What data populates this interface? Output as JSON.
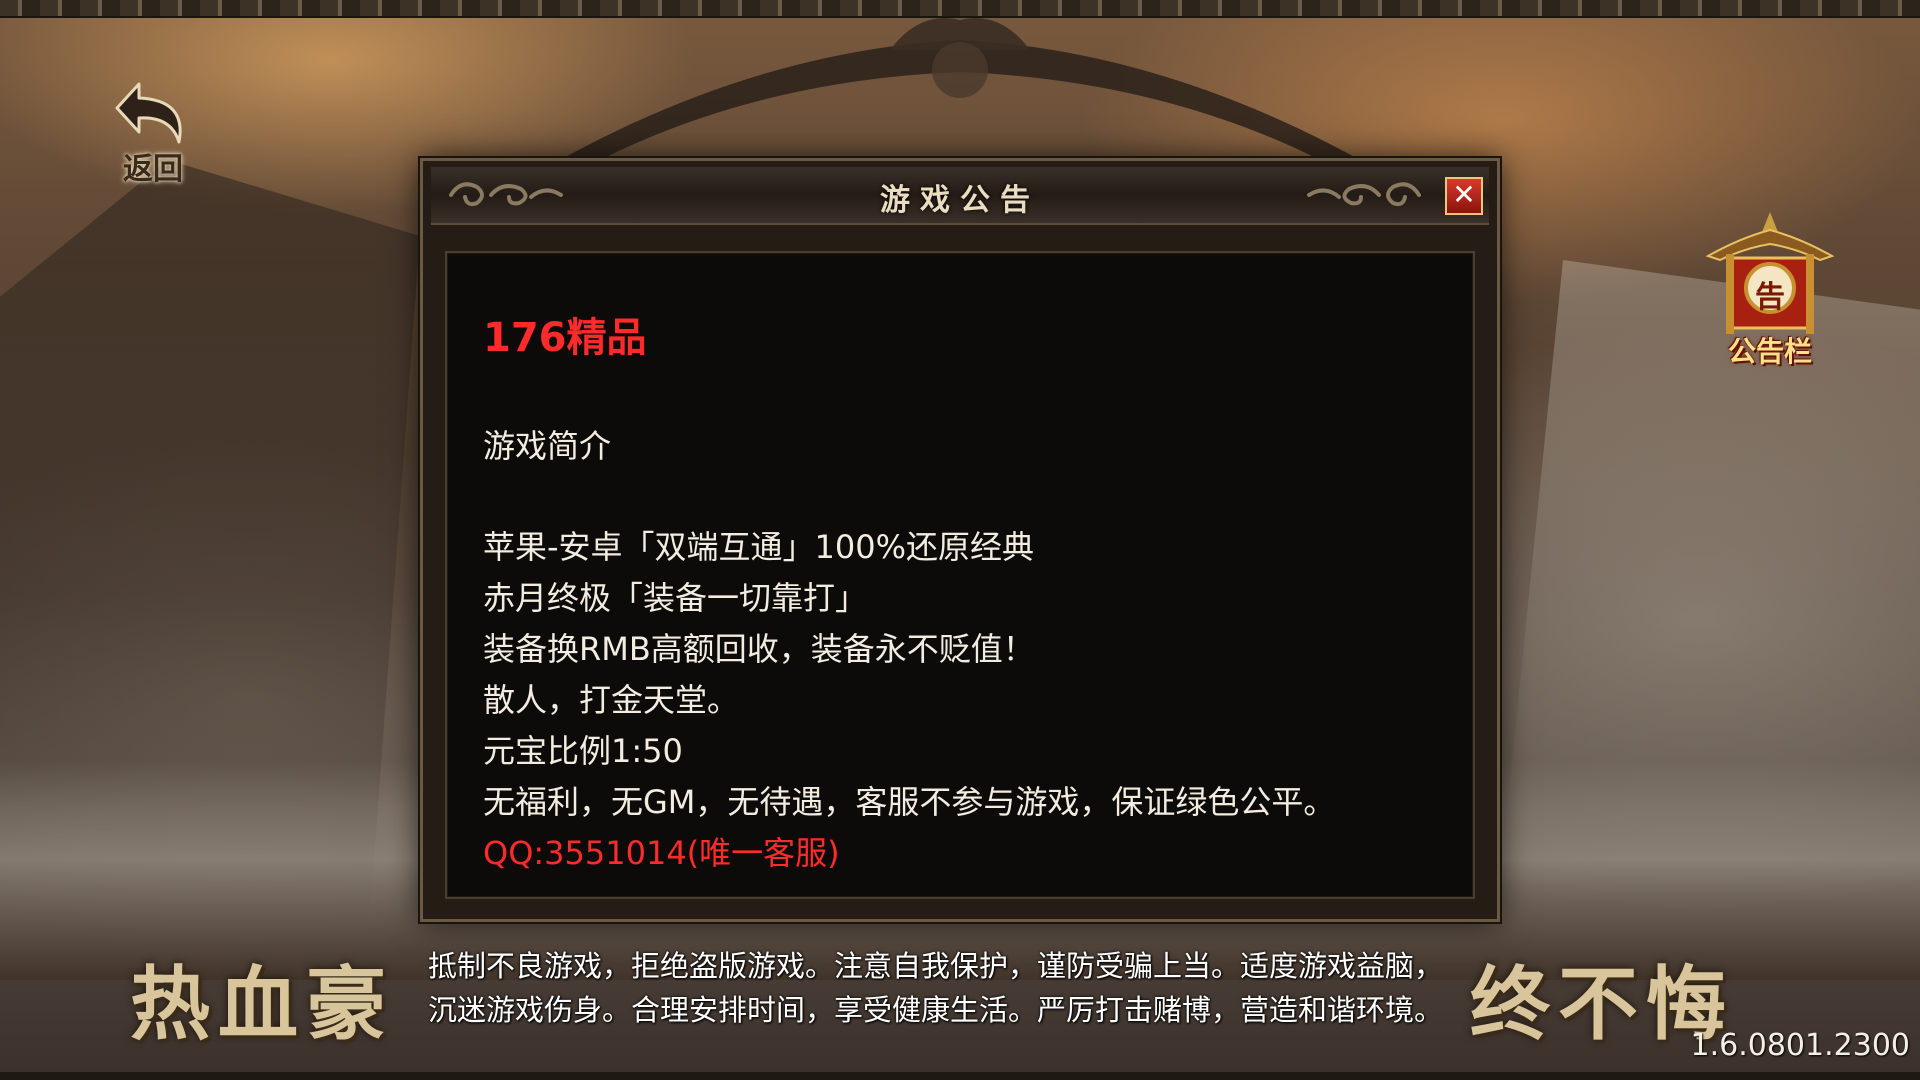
{
  "back_button": {
    "label": "返回",
    "icon": "curved-back-arrow-icon"
  },
  "notice_board": {
    "badge": "告",
    "label": "公告栏",
    "icon": "pavilion-icon"
  },
  "dialog": {
    "title": "游戏公告",
    "close_label": "✕",
    "content": {
      "headline": "176精品",
      "section_title": "游戏简介",
      "lines": [
        "苹果-安卓「双端互通」100%还原经典",
        "赤月终极「装备一切靠打」",
        "装备换RMB高额回收，装备永不贬值！",
        "散人，打金天堂。",
        "元宝比例1:50",
        "无福利，无GM，无待遇，客服不参与游戏，保证绿色公平。"
      ],
      "contact": "QQ:3551014(唯一客服)"
    }
  },
  "slogan": {
    "left": "热血豪",
    "right": "终不悔"
  },
  "health_notice": {
    "line1": "抵制不良游戏，拒绝盗版游戏。注意自我保护，谨防受骗上当。适度游戏益脑，",
    "line2": "沉迷游戏伤身。合理安排时间，享受健康生活。严厉打击赌博，营造和谐环境。"
  },
  "version": "1.6.0801.2300",
  "colors": {
    "accent_red": "#ff2a2a",
    "gold": "#ffe08a",
    "text": "#f3ece0"
  }
}
